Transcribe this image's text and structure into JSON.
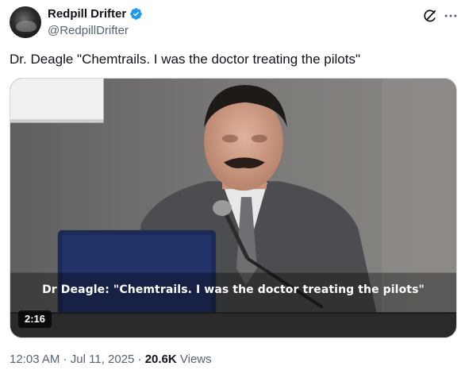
{
  "author": {
    "display_name": "Redpill Drifter",
    "handle": "@RedpillDrifter",
    "verified_icon": "verified-badge-icon",
    "verified_color": "#1d9bf0"
  },
  "header_actions": {
    "grok_icon": "grok-icon",
    "more_icon": "more-dots-icon"
  },
  "tweet": {
    "text": "Dr. Deagle \"Chemtrails. I was the doctor treating the pilots\""
  },
  "media": {
    "subtitle": "Dr Deagle: \"Chemtrails. I was the doctor treating the pilots\"",
    "duration": "2:16"
  },
  "meta": {
    "time": "12:03 AM",
    "separator": " · ",
    "date": "Jul 11, 2025",
    "views_count": "20.6K",
    "views_label": " Views"
  }
}
